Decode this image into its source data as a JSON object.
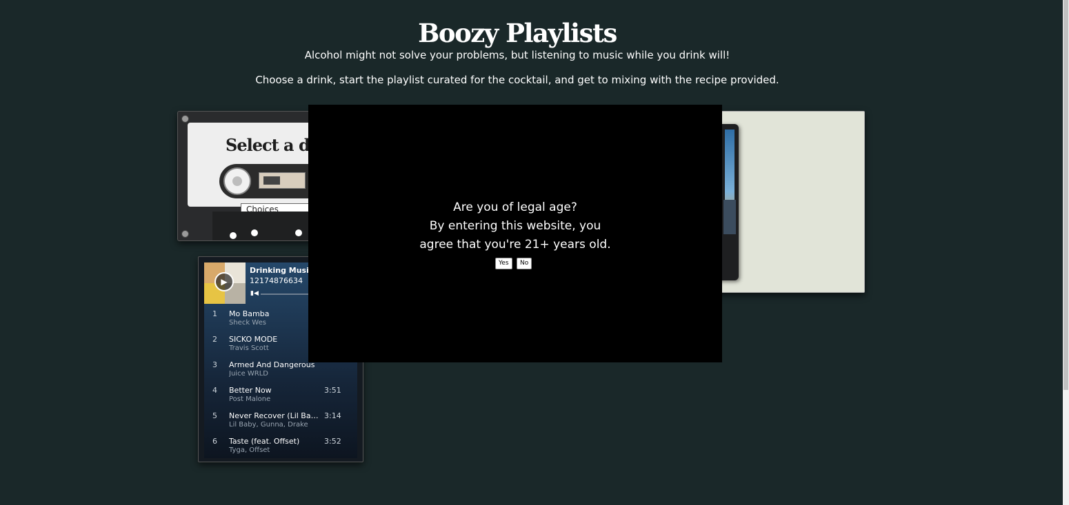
{
  "header": {
    "title": "Boozy Playlists",
    "tagline": "Alcohol might not solve your problems, but listening to music while you drink will!",
    "instructions": "Choose a drink, start the playlist curated for the cocktail, and get to mixing with the recipe provided."
  },
  "cassette": {
    "heading": "Select a drink",
    "select_value": "Choices"
  },
  "player": {
    "playlist_name": "Drinking Music",
    "owner": "12174876634",
    "tracks": [
      {
        "num": "1",
        "title": "Mo Bamba",
        "artist": "Sheck Wes",
        "duration": ""
      },
      {
        "num": "2",
        "title": "SICKO MODE",
        "artist": "Travis Scott",
        "duration": ""
      },
      {
        "num": "3",
        "title": "Armed And Dangerous",
        "artist": "Juice WRLD",
        "duration": ""
      },
      {
        "num": "4",
        "title": "Better Now",
        "artist": "Post Malone",
        "duration": "3:51"
      },
      {
        "num": "5",
        "title": "Never Recover (Lil Baby & Gunna, Drake)",
        "artist": "Lil Baby, Gunna, Drake",
        "duration": "3:14"
      },
      {
        "num": "6",
        "title": "Taste (feat. Offset)",
        "artist": "Tyga, Offset",
        "duration": "3:52"
      }
    ]
  },
  "age_modal": {
    "line1": "Are you of legal age?",
    "line2": "By entering this website, you",
    "line3": "agree that you're 21+ years old.",
    "yes_label": "Yes",
    "no_label": "No"
  },
  "colors": {
    "page_background": "#1a2829",
    "modal_background": "#000000",
    "recipe_card_background": "#e1e4d8"
  },
  "icons": [
    "play-icon",
    "skip-back-icon"
  ]
}
